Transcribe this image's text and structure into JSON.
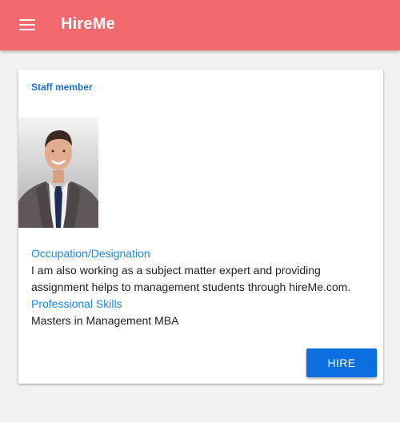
{
  "app": {
    "title": "HireMe",
    "menu_icon": "hamburger-menu-icon",
    "bar_color": "#f26a6d"
  },
  "card": {
    "header": "Staff member",
    "photo_description": "profile-photo",
    "occupation_label": "Occupation/Designation",
    "occupation_value": "I am also working as a subject matter expert and providing assignment helps to management students through hireMe.com.",
    "skills_label": "Professional Skills",
    "skills_value": "Masters in Management MBA",
    "hire_button": "HIRE",
    "accent_color": "#1e88e5",
    "button_color": "#0b6fe0"
  }
}
